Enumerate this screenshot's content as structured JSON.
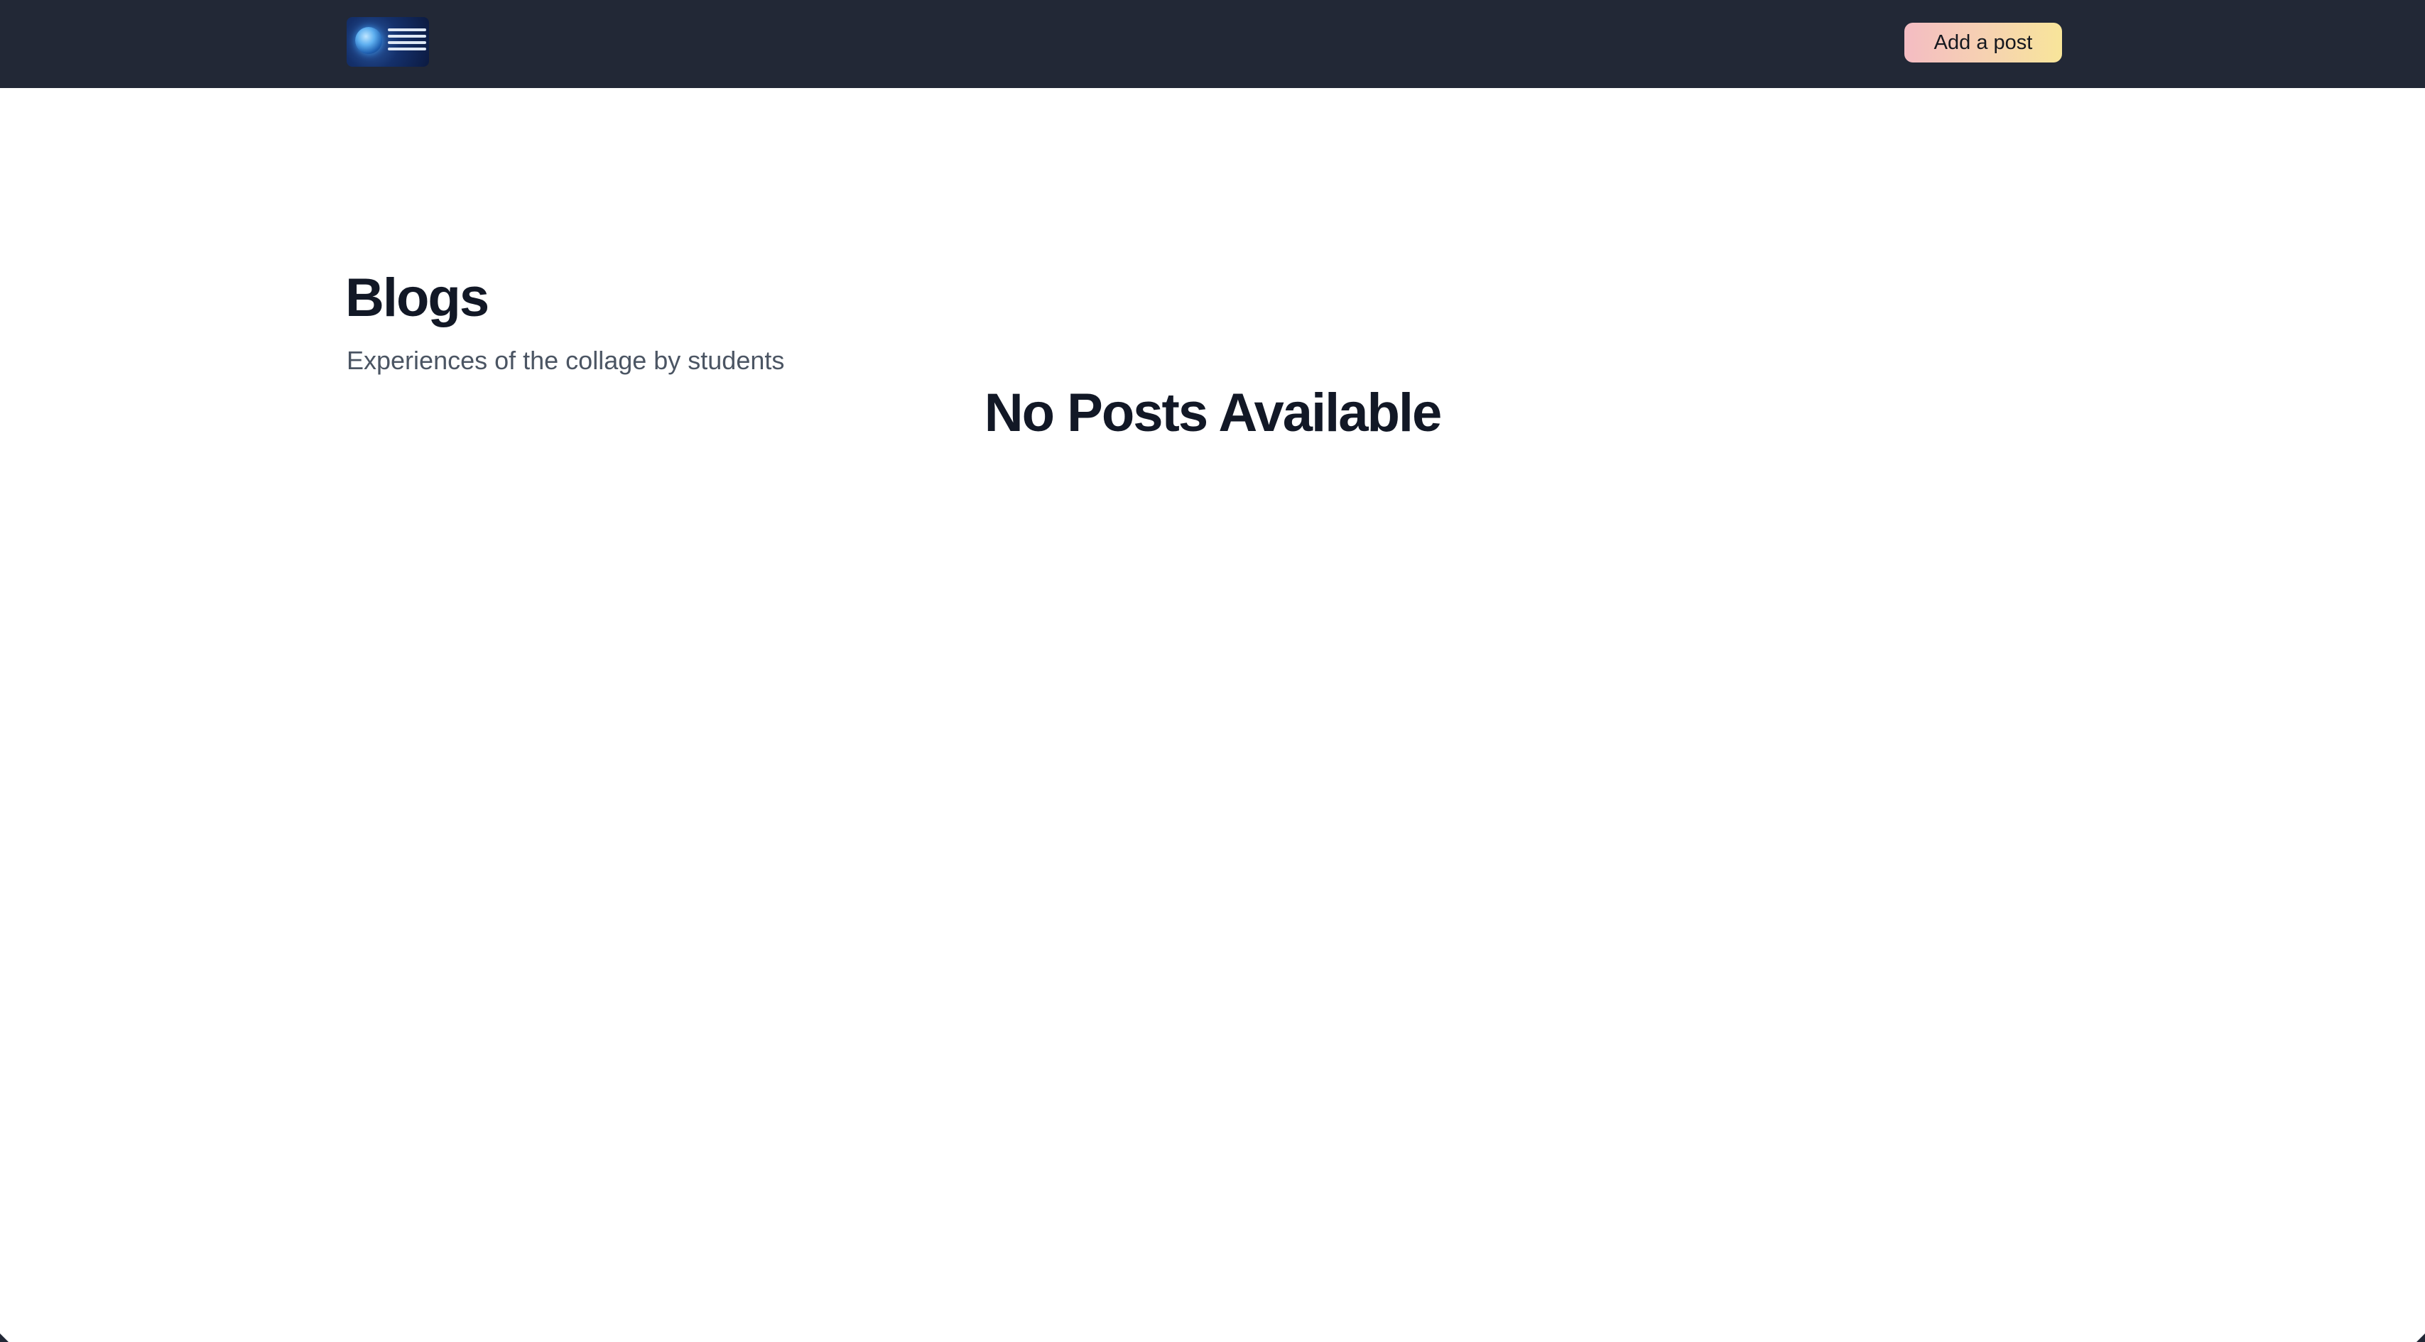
{
  "navbar": {
    "logo_icon": "attendance-face-recognition-logo",
    "add_post_label": "Add a post",
    "background_color": "#222836",
    "button_gradient": [
      "#f4bcc3",
      "#f8e59a"
    ]
  },
  "main": {
    "title": "Blogs",
    "subtitle": "Experiences of the collage by students",
    "empty_message": "No Posts Available"
  }
}
